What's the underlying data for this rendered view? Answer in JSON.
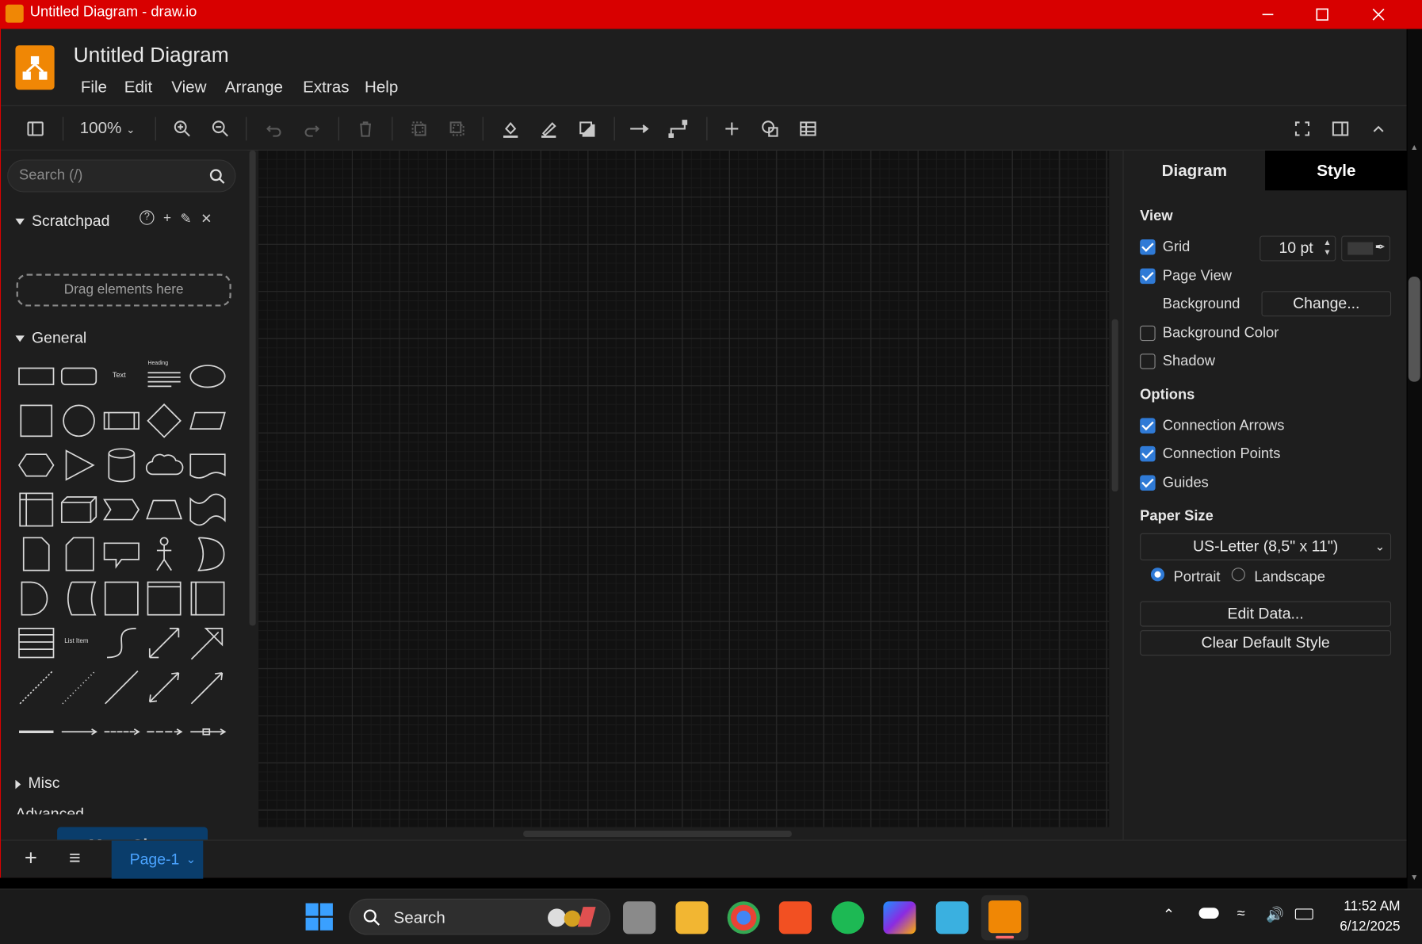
{
  "window": {
    "title": "Untitled Diagram - draw.io"
  },
  "app": {
    "doc_title": "Untitled Diagram",
    "menu": [
      "File",
      "Edit",
      "View",
      "Arrange",
      "Extras",
      "Help"
    ],
    "zoom": "100%",
    "toolbar_icons": [
      "sidebar-toggle-icon",
      "zoom-in-icon",
      "zoom-out-icon",
      "undo-icon",
      "redo-icon",
      "delete-icon",
      "to-front-icon",
      "to-back-icon",
      "fill-color-icon",
      "line-color-icon",
      "shadow-icon",
      "connection-icon",
      "waypoints-icon",
      "insert-icon",
      "shapes-icon",
      "table-icon",
      "fullscreen-icon",
      "format-panel-icon",
      "collapse-icon"
    ]
  },
  "left_panel": {
    "search_placeholder": "Search (/)",
    "scratchpad_title": "Scratchpad",
    "scratchpad_drop": "Drag elements here",
    "general_title": "General",
    "shape_text_label": "Text",
    "shape_heading_label": "Heading",
    "shape_listitem_label": "List Item",
    "misc_title": "Misc",
    "advanced_title": "Advanced",
    "more_shapes": "+ More Shapes"
  },
  "right_panel": {
    "tabs": [
      "Diagram",
      "Style"
    ],
    "view_header": "View",
    "grid_label": "Grid",
    "grid_size": "10 pt",
    "grid_checked": true,
    "page_view_label": "Page View",
    "page_view_checked": true,
    "background_label": "Background",
    "change_button": "Change...",
    "background_color_label": "Background Color",
    "background_color_checked": false,
    "shadow_label": "Shadow",
    "shadow_checked": false,
    "options_header": "Options",
    "connection_arrows_label": "Connection Arrows",
    "connection_points_label": "Connection Points",
    "guides_label": "Guides",
    "paper_size_header": "Paper Size",
    "paper_size_value": "US-Letter (8,5\" x 11\")",
    "portrait_label": "Portrait",
    "landscape_label": "Landscape",
    "orientation": "Portrait",
    "edit_data_button": "Edit Data...",
    "clear_default_style_button": "Clear Default Style"
  },
  "page_bar": {
    "page_tab": "Page-1"
  },
  "taskbar": {
    "search_placeholder": "Search",
    "time": "11:52 AM",
    "date": "6/12/2025",
    "apps": [
      "windows-start-icon",
      "file-explorer-icon",
      "chrome-icon",
      "store-icon",
      "spotify-icon",
      "m365-icon",
      "notepad-icon",
      "drawio-icon"
    ]
  },
  "colors": {
    "titlebar": "#d80000",
    "accent": "#2f7ad6",
    "page_tab_bg": "#0a3d6b",
    "drawio_orange": "#f08705"
  }
}
